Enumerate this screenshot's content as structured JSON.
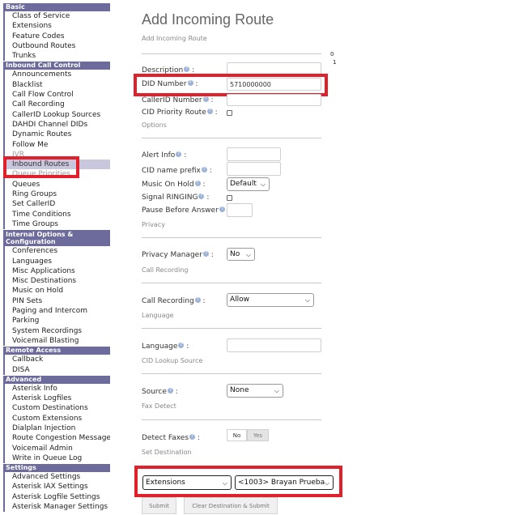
{
  "sidebar": {
    "sections": [
      {
        "title": "Basic",
        "items": [
          "Class of Service",
          "Extensions",
          "Feature Codes",
          "Outbound Routes",
          "Trunks"
        ]
      },
      {
        "title": "Inbound Call Control",
        "items": [
          "Announcements",
          "Blacklist",
          "Call Flow Control",
          "Call Recording",
          "CallerID Lookup Sources",
          "DAHDI Channel DIDs",
          "Dynamic Routes",
          "Follow Me",
          "IVR",
          "Inbound Routes",
          "Queue Priorities",
          "Queues",
          "Ring Groups",
          "Set CallerID",
          "Time Conditions",
          "Time Groups"
        ]
      },
      {
        "title": "Internal Options & Configuration",
        "items": [
          "Conferences",
          "Languages",
          "Misc Applications",
          "Misc Destinations",
          "Music on Hold",
          "PIN Sets",
          "Paging and Intercom",
          "Parking",
          "System Recordings",
          "Voicemail Blasting"
        ]
      },
      {
        "title": "Remote Access",
        "items": [
          "Callback",
          "DISA"
        ]
      },
      {
        "title": "Advanced",
        "items": [
          "Asterisk Info",
          "Asterisk Logfiles",
          "Custom Destinations",
          "Custom Extensions",
          "Dialplan Injection",
          "Route Congestion Messages",
          "Voicemail Admin",
          "Write in Queue Log"
        ]
      },
      {
        "title": "Settings",
        "items": [
          "Advanced Settings",
          "Asterisk IAX Settings",
          "Asterisk Logfile Settings",
          "Asterisk Manager Settings"
        ]
      }
    ],
    "active_item": "Inbound Routes"
  },
  "page": {
    "title": "Add Incoming Route",
    "subtitle": "Add Incoming Route",
    "side_counter": [
      "0",
      "1"
    ]
  },
  "form": {
    "description_label": "Description",
    "did_number_label": "DID Number",
    "did_number_value": "5710000000",
    "callerid_number_label": "CallerID Number",
    "cid_priority_label": "CID Priority Route",
    "options_section": "Options",
    "alert_info_label": "Alert Info",
    "cid_name_prefix_label": "CID name prefix",
    "music_on_hold_label": "Music On Hold",
    "music_on_hold_value": "Default",
    "signal_ringing_label": "Signal RINGING",
    "pause_before_answer_label": "Pause Before Answer",
    "privacy_section": "Privacy",
    "privacy_manager_label": "Privacy Manager",
    "privacy_manager_value": "No",
    "call_recording_section": "Call Recording",
    "call_recording_label": "Call Recording",
    "call_recording_value": "Allow",
    "language_section": "Language",
    "language_label": "Language",
    "cid_lookup_section": "CID Lookup Source",
    "source_label": "Source",
    "source_value": "None",
    "fax_detect_section": "Fax Detect",
    "detect_faxes_label": "Detect Faxes",
    "detect_faxes_no": "No",
    "detect_faxes_yes": "Yes",
    "set_destination_section": "Set Destination",
    "destination_type_value": "Extensions",
    "destination_value": "<1003> Brayan Prueba"
  },
  "buttons": {
    "submit": "Submit",
    "clear_submit": "Clear Destination & Submit"
  },
  "icons": {
    "help": "help-icon",
    "dropdown": "chevron-down-icon"
  },
  "colors": {
    "sidebar_header": "#6d6b9b",
    "sidebar_active": "#c8c7de",
    "highlight": "#e0202a"
  }
}
